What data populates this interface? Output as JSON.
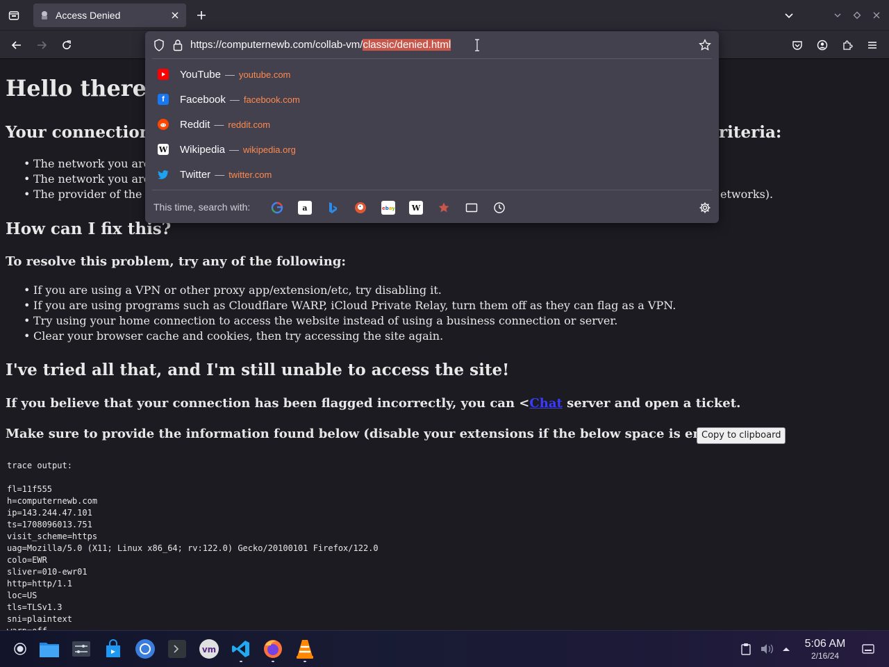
{
  "browser": {
    "tab": {
      "title": "Access Denied"
    },
    "urlbar": {
      "url_prefix": "https://computernewb.com/collab-vm/",
      "url_selected": "classic/denied.html"
    },
    "suggestions": [
      {
        "name": "YouTube",
        "url": "youtube.com",
        "color": "#ff0000",
        "icon": "youtube-icon"
      },
      {
        "name": "Facebook",
        "url": "facebook.com",
        "color": "#1877f2",
        "icon": "facebook-icon"
      },
      {
        "name": "Reddit",
        "url": "reddit.com",
        "color": "#ff4500",
        "icon": "reddit-icon"
      },
      {
        "name": "Wikipedia",
        "url": "wikipedia.org",
        "color": "#ffffff",
        "icon": "wikipedia-icon"
      },
      {
        "name": "Twitter",
        "url": "twitter.com",
        "color": "#1da1f2",
        "icon": "twitter-icon"
      }
    ],
    "search_with_label": "This time, search with:",
    "search_engines": [
      "google-icon",
      "amazon-icon",
      "bing-icon",
      "duckduckgo-icon",
      "ebay-icon",
      "wikipedia-icon",
      "bookmarks-icon",
      "tabs-icon",
      "history-icon"
    ]
  },
  "page": {
    "heading": "Hello there!",
    "connection_heading_left": "Your connection",
    "connection_heading_right": "riteria:",
    "criteria": [
      "The network you are",
      "The network you are",
      "The provider of the n"
    ],
    "criteria_tail": "etworks).",
    "fix_heading": "How can I fix this?",
    "resolve_heading": "To resolve this problem, try any of the following:",
    "fixes": [
      "If you are using a VPN or other proxy app/extension/etc, try disabling it.",
      "If you are using programs such as Cloudflare WARP, iCloud Private Relay, turn them off as they can flag as a VPN.",
      "Try using your home connection to access the website instead of using a business connection or server.",
      "Clear your browser cache and cookies, then try accessing the site again."
    ],
    "tried_heading": "I've tried all that, and I'm still unable to access the site!",
    "flagged_before": "If you believe that your connection has been flagged incorrectly, you can <",
    "flagged_link": "Chat",
    "flagged_after": " server and open a ticket.",
    "provide_info": "Make sure to provide the information found below (disable your extensions if the below space is empty):",
    "copy_button": "Copy to clipboard",
    "trace_output": "trace output:\n\nfl=11f555\nh=computernewb.com\nip=143.244.47.101\nts=1708096013.751\nvisit_scheme=https\nuag=Mozilla/5.0 (X11; Linux x86_64; rv:122.0) Gecko/20100101 Firefox/122.0\ncolo=EWR\nsliver=010-ewr01\nhttp=http/1.1\nloc=US\ntls=TLSv1.3\nsni=plaintext\nwarp=off"
  },
  "taskbar": {
    "apps": [
      "app-launcher-icon",
      "file-manager-icon",
      "system-settings-icon",
      "discover-store-icon",
      "chromium-icon",
      "terminal-icon",
      "virt-manager-icon",
      "vscode-icon",
      "firefox-icon",
      "vlc-icon"
    ],
    "clock": {
      "time": "5:06 AM",
      "date": "2/16/24"
    }
  }
}
